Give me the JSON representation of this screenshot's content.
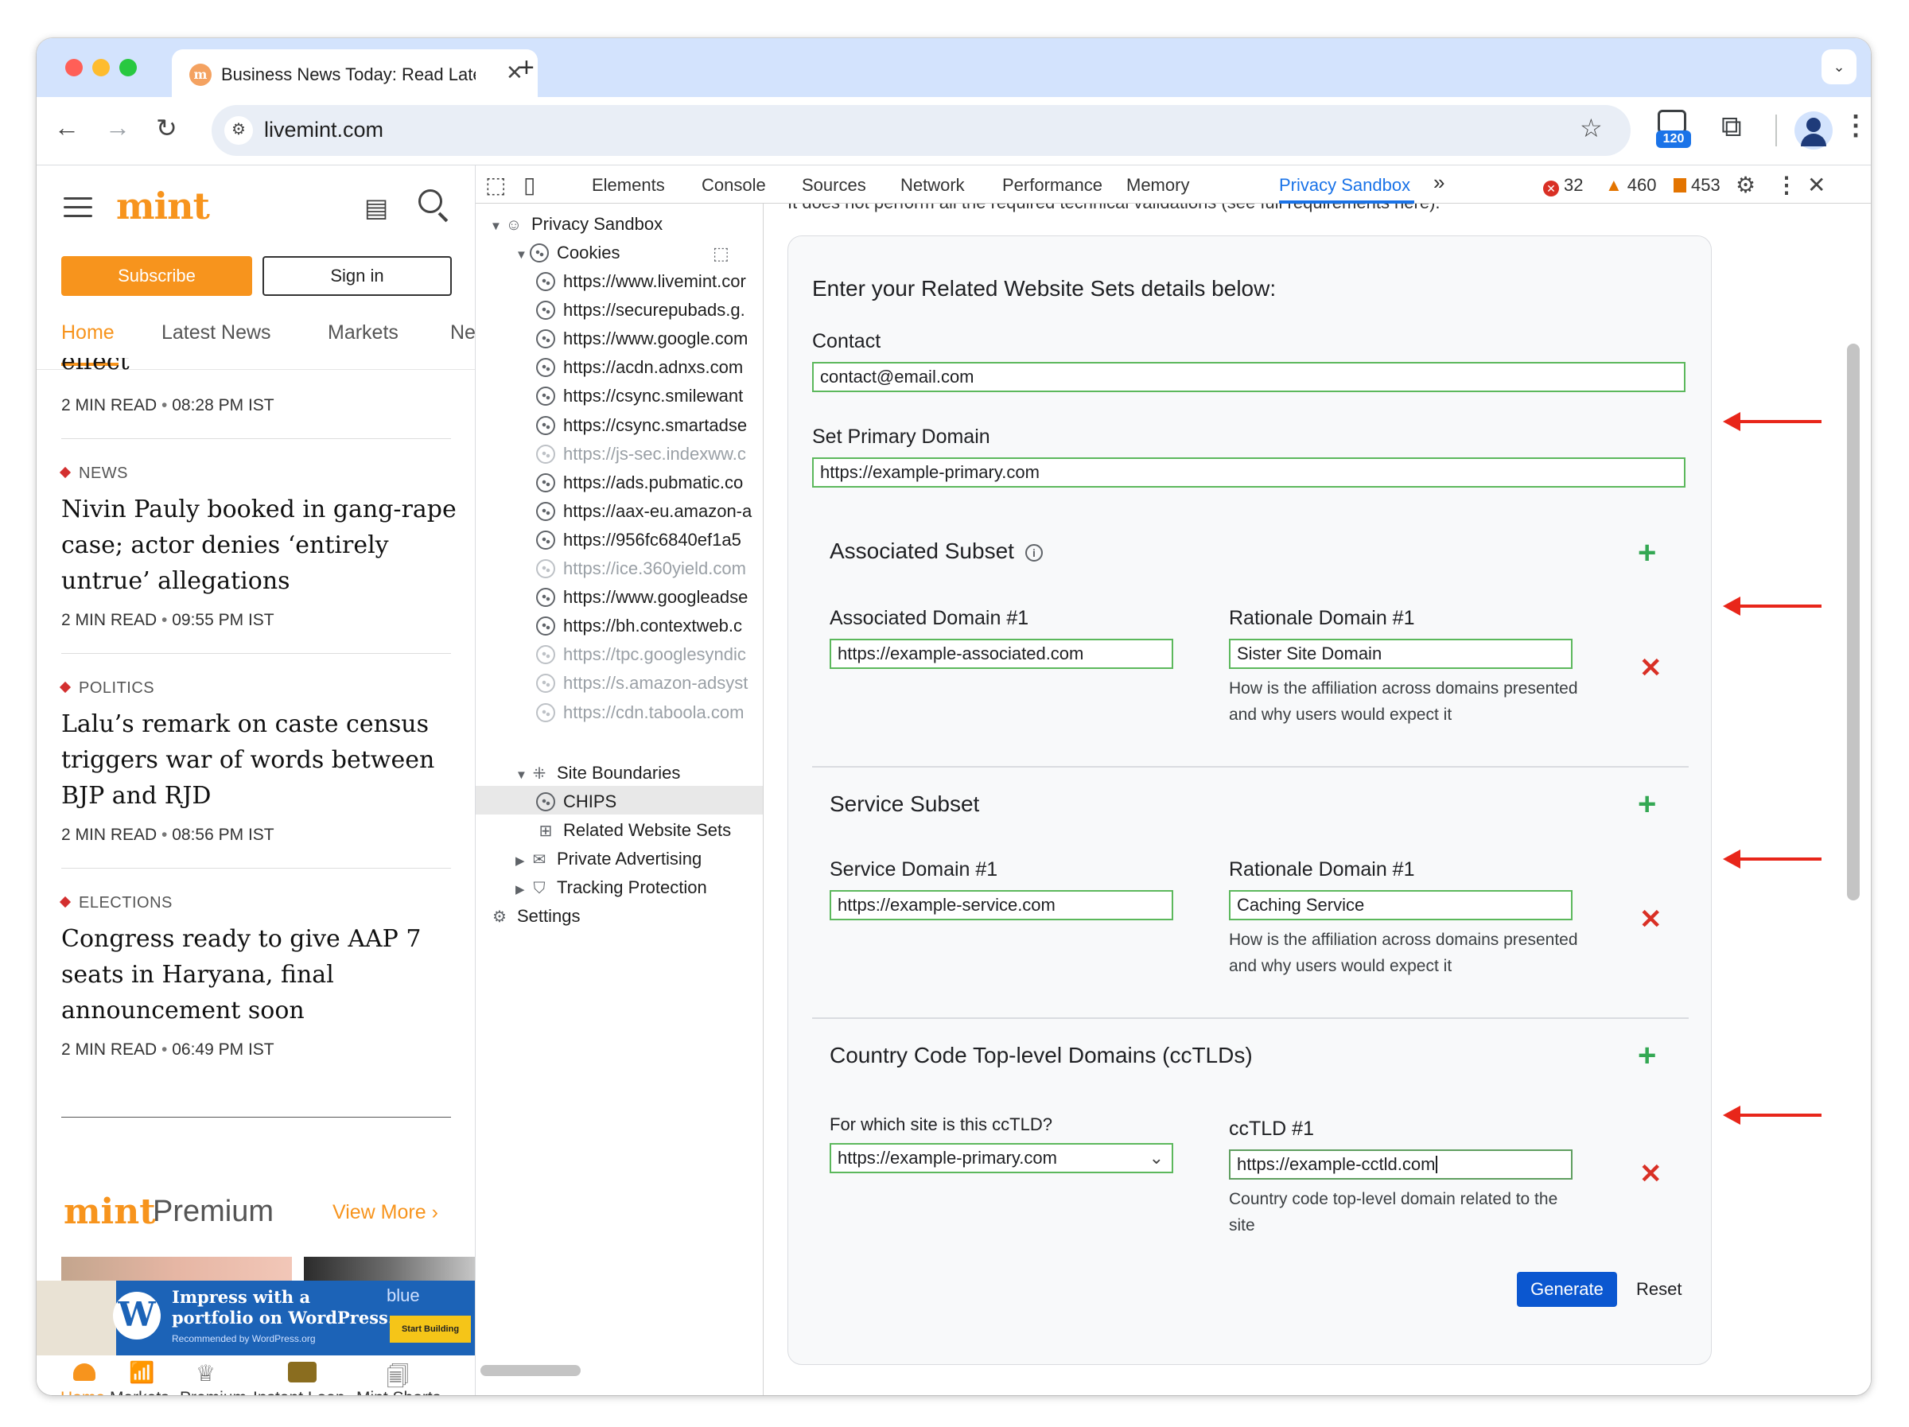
{
  "browser": {
    "tab_title": "Business News Today: Read Latest",
    "tab_icon": "mint-favicon",
    "url": "livemint.com",
    "extension_badge": "120",
    "colors": {
      "tabbar": "#d3e3fd",
      "accent": "#1a73e8"
    }
  },
  "site": {
    "logo": "mint",
    "subscribe": "Subscribe",
    "signin": "Sign in",
    "nav": [
      "Home",
      "Latest News",
      "Markets",
      "Ne"
    ],
    "articles": [
      {
        "category": "",
        "headline": "effect",
        "read": "2 MIN READ",
        "time": "08:28 PM IST"
      },
      {
        "category": "NEWS",
        "headline": "Nivin Pauly booked in gang-rape case; actor denies ‘entirely untrue’ allegations",
        "read": "2 MIN READ",
        "time": "09:55 PM IST"
      },
      {
        "category": "POLITICS",
        "headline": "Lalu’s remark on caste census triggers war of words between BJP and RJD",
        "read": "2 MIN READ",
        "time": "08:56 PM IST"
      },
      {
        "category": "ELECTIONS",
        "headline": "Congress ready to give AAP 7 seats in Haryana, final announcement soon",
        "read": "2 MIN READ",
        "time": "06:49 PM IST"
      }
    ],
    "premium": {
      "logo": "mint",
      "word": "Premium",
      "view_more": "View More ›"
    },
    "ad": {
      "line1": "Impress with a",
      "line2": "portfolio on WordPress.",
      "small": "Recommended by WordPress.org",
      "button": "Start Building",
      "brand": "blue"
    },
    "bottom_nav": [
      "Home",
      "Markets",
      "Premium",
      "Instant Loan",
      "Mint Shorts"
    ],
    "accent": "#f7941d"
  },
  "devtools": {
    "tabs": [
      "Elements",
      "Console",
      "Sources",
      "Network",
      "Performance",
      "Memory",
      "Privacy Sandbox"
    ],
    "more": "»",
    "errors": "32",
    "warnings": "460",
    "issues": "453",
    "tree": {
      "root": "Privacy Sandbox",
      "cookies": "Cookies",
      "cookie_items": [
        {
          "url": "https://www.livemint.cor",
          "dim": false
        },
        {
          "url": "https://securepubads.g.",
          "dim": false
        },
        {
          "url": "https://www.google.com",
          "dim": false
        },
        {
          "url": "https://acdn.adnxs.com",
          "dim": false
        },
        {
          "url": "https://csync.smilewant",
          "dim": false
        },
        {
          "url": "https://csync.smartadse",
          "dim": false
        },
        {
          "url": "https://js-sec.indexww.c",
          "dim": true
        },
        {
          "url": "https://ads.pubmatic.co",
          "dim": false
        },
        {
          "url": "https://aax-eu.amazon-a",
          "dim": false
        },
        {
          "url": "https://956fc6840ef1a5",
          "dim": false
        },
        {
          "url": "https://ice.360yield.com",
          "dim": true
        },
        {
          "url": "https://www.googleadse",
          "dim": false
        },
        {
          "url": "https://bh.contextweb.c",
          "dim": false
        },
        {
          "url": "https://tpc.googlesyndic",
          "dim": true
        },
        {
          "url": "https://s.amazon-adsyst",
          "dim": true
        },
        {
          "url": "https://cdn.taboola.com",
          "dim": true
        }
      ],
      "site_boundaries": "Site Boundaries",
      "chips": "CHIPS",
      "rws": "Related Website Sets",
      "private_ads": "Private Advertising",
      "tracking": "Tracking Protection",
      "settings": "Settings"
    },
    "form": {
      "top_clip": "It does not perform all the required technical validations (see full requirements here).",
      "heading": "Enter your Related Website Sets details below:",
      "contact_label": "Contact",
      "contact_value": "contact@email.com",
      "primary_label": "Set Primary Domain",
      "primary_value": "https://example-primary.com",
      "associated": {
        "title": "Associated Subset",
        "domain_label": "Associated Domain #1",
        "domain_value": "https://example-associated.com",
        "rationale_label": "Rationale Domain #1",
        "rationale_value": "Sister Site Domain",
        "help": "How is the affiliation across domains presented and why users would expect it"
      },
      "service": {
        "title": "Service Subset",
        "domain_label": "Service Domain #1",
        "domain_value": "https://example-service.com",
        "rationale_label": "Rationale Domain #1",
        "rationale_value": "Caching Service",
        "help": "How is the affiliation across domains presented and why users would expect it"
      },
      "cctld": {
        "title": "Country Code Top-level Domains (ccTLDs)",
        "site_label": "For which site is this ccTLD?",
        "site_value": "https://example-primary.com",
        "cctld_label": "ccTLD #1",
        "cctld_value": "https://example-cctld.com",
        "help": "Country code top-level domain related to the site"
      },
      "generate": "Generate",
      "reset": "Reset"
    }
  }
}
